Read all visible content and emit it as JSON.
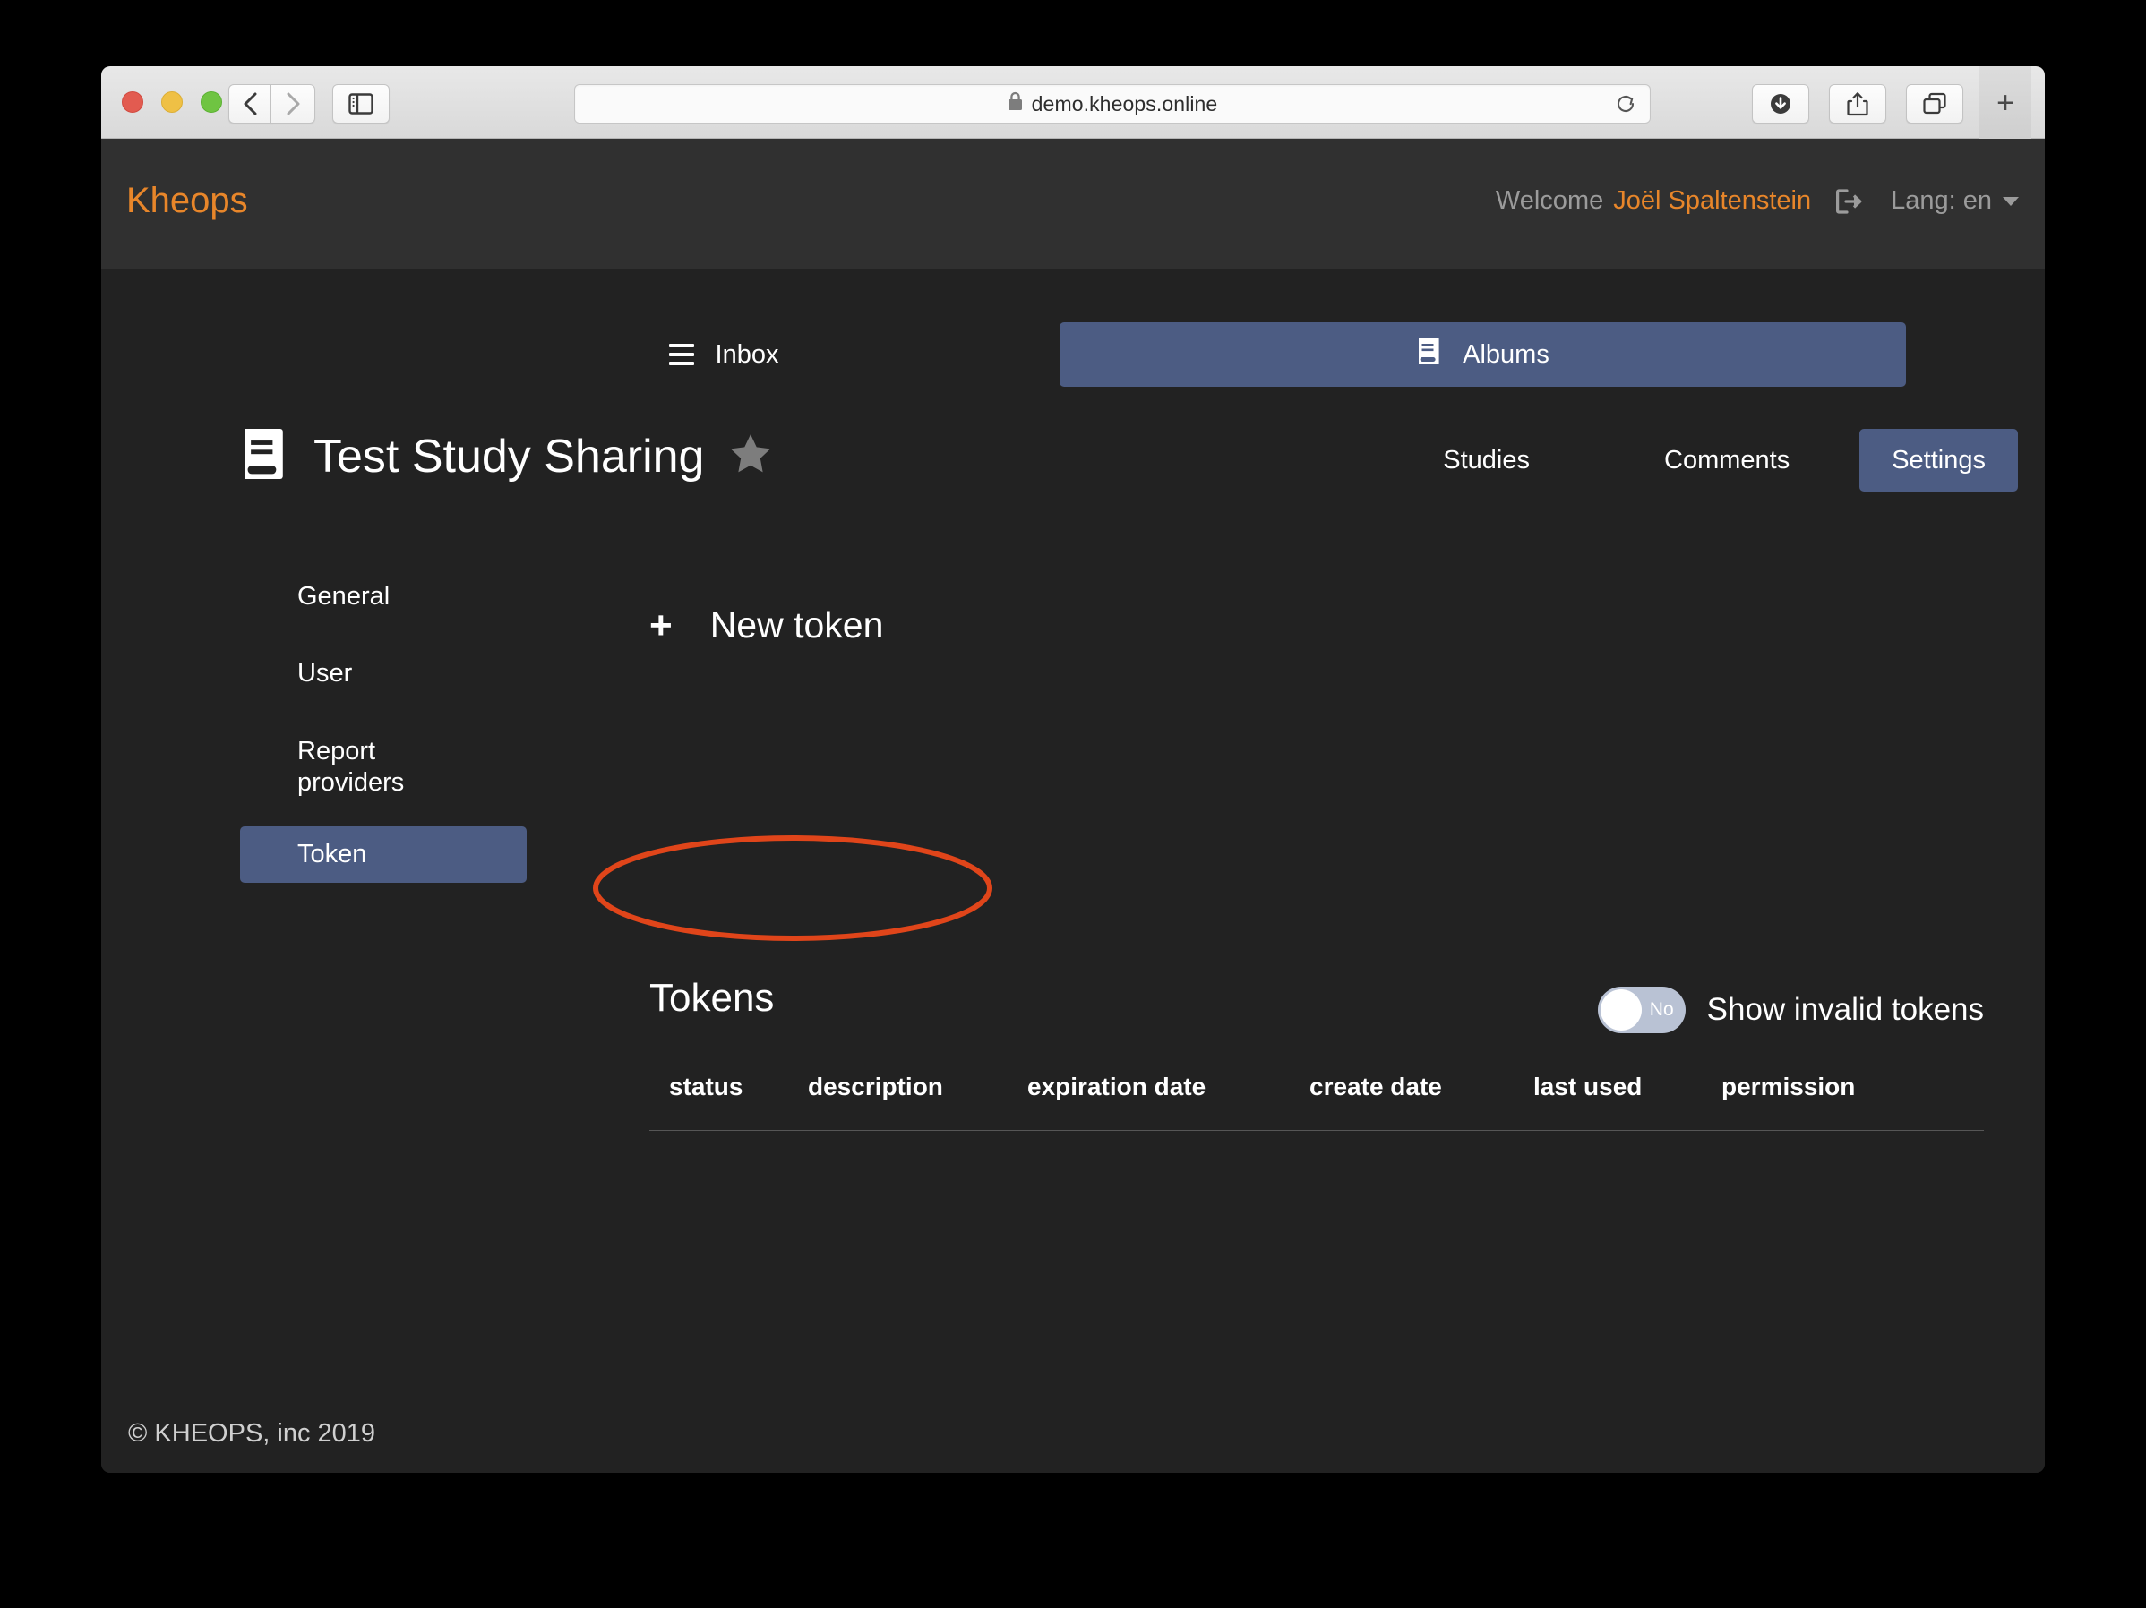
{
  "browser": {
    "url": "demo.kheops.online",
    "lock_icon": "lock-icon",
    "back_icon": "chevron-left-icon",
    "forward_icon": "chevron-right-icon",
    "sidebar_icon": "sidebar-toggle-icon",
    "reload_icon": "reload-icon",
    "download_icon": "download-icon",
    "share_icon": "share-icon",
    "tabs_icon": "tab-overview-icon",
    "new_tab_label": "+"
  },
  "header": {
    "brand": "Kheops",
    "welcome_label": "Welcome",
    "welcome_user": "Joël Spaltenstein",
    "logout_icon": "logout-icon",
    "lang_label": "Lang: en",
    "brand_color": "#e8862a"
  },
  "nav_tabs": {
    "inbox_label": "Inbox",
    "inbox_icon": "hamburger-icon",
    "albums_label": "Albums",
    "albums_icon": "album-book-icon",
    "active": "Albums",
    "active_color": "#4c5c83"
  },
  "album": {
    "icon": "album-book-icon",
    "title": "Test Study Sharing",
    "favorite_icon": "star-icon",
    "favorite_active": false,
    "tabs": [
      {
        "label": "Studies",
        "active": false
      },
      {
        "label": "Comments",
        "active": false
      },
      {
        "label": "Settings",
        "active": true
      }
    ]
  },
  "settings_nav": {
    "items": [
      {
        "label": "General",
        "active": false
      },
      {
        "label": "User",
        "active": false
      },
      {
        "label": "Report providers",
        "active": false
      },
      {
        "label": "Token",
        "active": true
      }
    ]
  },
  "actions": {
    "new_token_plus": "+",
    "new_token_label": "New token",
    "highlight_color": "#e0451a"
  },
  "tokens": {
    "heading": "Tokens",
    "show_invalid_label": "Show invalid tokens",
    "toggle_state": "No",
    "toggle_on": false,
    "columns": [
      "status",
      "description",
      "expiration date",
      "create date",
      "last used",
      "permission"
    ],
    "rows": []
  },
  "footer": {
    "copyright": "© KHEOPS, inc 2019"
  }
}
